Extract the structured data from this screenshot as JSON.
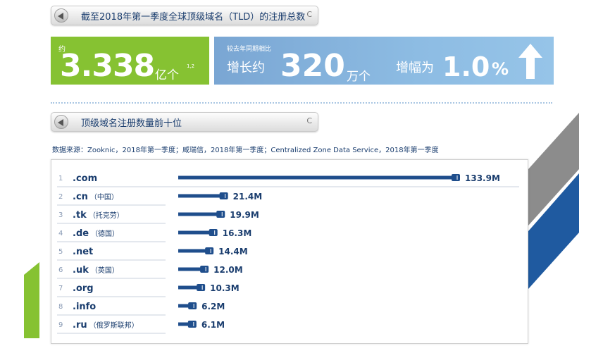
{
  "header1": {
    "title": "截至2018年第一季度全球顶级域名（TLD）的注册总数",
    "refresh": "C"
  },
  "stat_total": {
    "caption": "约",
    "value": "3.338",
    "unit": "亿个",
    "note": "1,2"
  },
  "stat_growth": {
    "caption": "较去年同期相比",
    "label_increase": "增长约",
    "increase_value": "320",
    "increase_unit": "万个",
    "label_rate": "增幅为",
    "rate_value": "1.0",
    "rate_unit": "%"
  },
  "header2": {
    "title": "顶级域名注册数量前十位",
    "refresh": "C"
  },
  "source_text": "数据来源：Zooknic，2018年第一季度；威瑞信，2018年第一季度；Centralized Zone Data Service，2018年第一季度",
  "colors": {
    "green": "#86c232",
    "blue_box": "#8dbce3",
    "bar": "#1f4e8c",
    "gray_deco": "#8c8c8c",
    "navy_deco": "#1f5aa0"
  },
  "chart_data": {
    "type": "bar",
    "orientation": "horizontal",
    "ranks": [
      "1",
      "2",
      "3",
      "4",
      "5",
      "6",
      "7",
      "8",
      "9"
    ],
    "categories": [
      ".com",
      ".cn",
      ".tk",
      ".de",
      ".net",
      ".uk",
      ".org",
      ".info",
      ".ru"
    ],
    "subtitles": [
      "",
      "（中国）",
      "（托克劳）",
      "（德国）",
      "",
      "（英国）",
      "",
      "",
      "（俄罗斯联邦）"
    ],
    "values": [
      133.9,
      21.4,
      19.9,
      16.3,
      14.4,
      12.0,
      10.3,
      6.2,
      6.1
    ],
    "value_labels": [
      "133.9M",
      "21.4M",
      "19.9M",
      "16.3M",
      "14.4M",
      "12.0M",
      "10.3M",
      "6.2M",
      "6.1M"
    ],
    "unit": "M"
  }
}
